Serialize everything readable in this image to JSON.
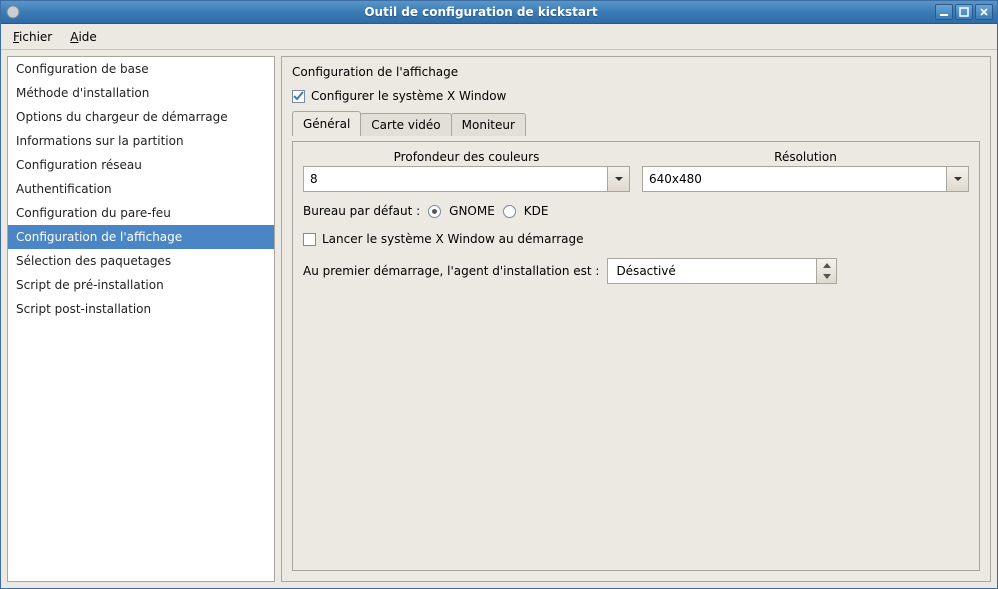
{
  "window": {
    "title": "Outil de configuration de kickstart"
  },
  "menubar": {
    "file": "Fichier",
    "file_ul": "F",
    "help": "Aide",
    "help_ul": "A"
  },
  "sidebar": {
    "items": [
      "Configuration de base",
      "Méthode d'installation",
      "Options du chargeur de démarrage",
      "Informations sur la partition",
      "Configuration réseau",
      "Authentification",
      "Configuration du pare-feu",
      "Configuration de l'affichage",
      "Sélection des paquetages",
      "Script de pré-installation",
      "Script post-installation"
    ],
    "selected_index": 7
  },
  "main": {
    "section_title": "Configuration de l'affichage",
    "configure_x_label": "Configurer le système X Window",
    "configure_x_checked": true,
    "tabs": [
      "Général",
      "Carte vidéo",
      "Moniteur"
    ],
    "active_tab": 0,
    "general": {
      "color_depth_label": "Profondeur des couleurs",
      "color_depth_value": "8",
      "resolution_label": "Résolution",
      "resolution_value": "640x480",
      "default_desktop_label": "Bureau par défaut :",
      "desktop_gnome": "GNOME",
      "desktop_kde": "KDE",
      "desktop_selected": "GNOME",
      "start_x_label": "Lancer le système X Window au démarrage",
      "start_x_checked": false,
      "firstboot_label": "Au premier démarrage, l'agent d'installation est :",
      "firstboot_value": "Désactivé"
    }
  }
}
